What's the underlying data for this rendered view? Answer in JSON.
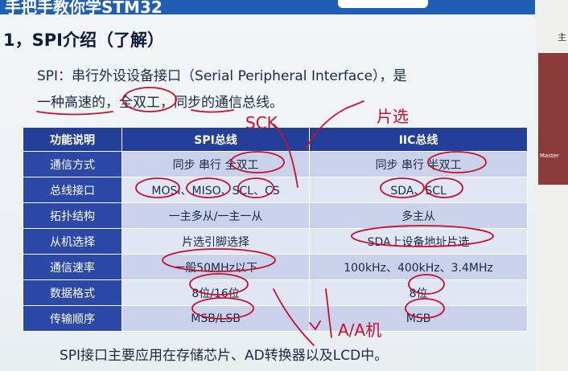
{
  "slide": {
    "header_title": "手把手教你学STM32",
    "heading": "1，SPI介绍（了解）",
    "intro_prefix": "SPI：串行外设设备接口（Serial Peripheral Interface），是",
    "intro_line2": "一种高速的，全双工，同步的通信总线。",
    "footer": "SPI接口主要应用在存储芯片、AD转换器以及LCD中。"
  },
  "table": {
    "headers": [
      "功能说明",
      "SPI总线",
      "IIC总线"
    ],
    "rows": [
      [
        "通信方式",
        "同步 串行 全双工",
        "同步 串行 半双工"
      ],
      [
        "总线接口",
        "MOSI、MISO、SCL、CS",
        "SDA、SCL"
      ],
      [
        "拓扑结构",
        "一主多从/一主一从",
        "多主从"
      ],
      [
        "从机选择",
        "片选引脚选择",
        "SDA上设备地址片选"
      ],
      [
        "通信速率",
        "一般50MHz以下",
        "100kHz、400kHz、3.4MHz"
      ],
      [
        "数据格式",
        "8位/16位",
        "8位"
      ],
      [
        "传输顺序",
        "MSB/LSB",
        "MSB"
      ]
    ]
  },
  "annotations": {
    "note_1": "SCK",
    "note_2": "片选",
    "note_3": "A/A机"
  },
  "side_panel": {
    "char": "主",
    "thumb_label": "Master"
  },
  "colors": {
    "header_bar": "#1f5fb5",
    "table_header": "#233f9a",
    "row_odd": "#c9d2ea",
    "row_even": "#e1e6f4",
    "ink": "#c8102e"
  }
}
